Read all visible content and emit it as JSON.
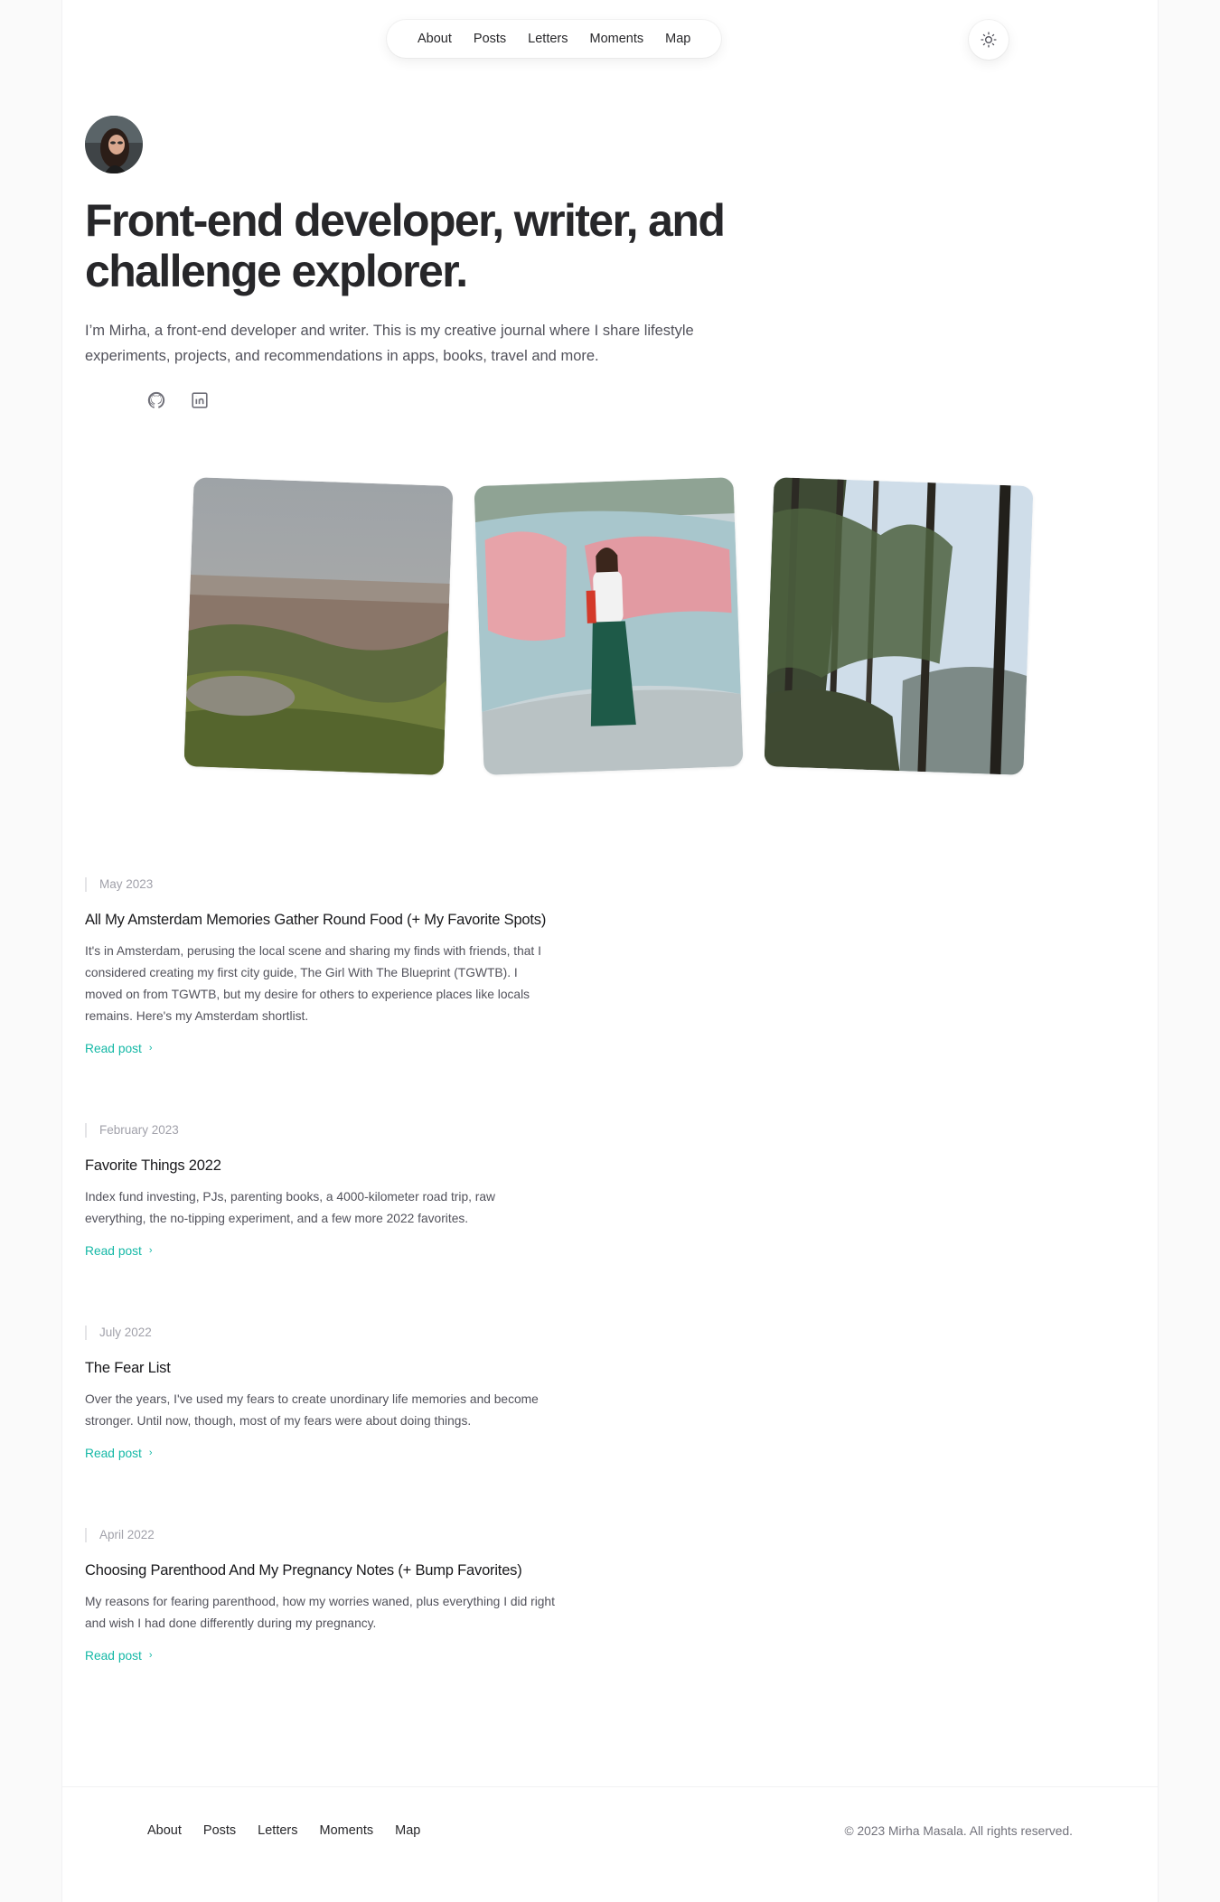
{
  "nav": {
    "items": [
      "About",
      "Posts",
      "Letters",
      "Moments",
      "Map"
    ],
    "theme_icon": "sun-icon"
  },
  "hero": {
    "avatar_alt": "avatar",
    "title": "Front-end developer, writer, and challenge explorer.",
    "intro": "I’m Mirha, a front-end developer and writer. This is my creative journal where I share lifestyle experiments, projects, and recommendations in apps, books, travel and more.",
    "social": [
      "github-icon",
      "linkedin-icon"
    ]
  },
  "photos": [
    "city-landscape-photo",
    "graffiti-wall-photo",
    "forest-trees-photo"
  ],
  "posts": [
    {
      "date": "May 2023",
      "title": "All My Amsterdam Memories Gather Round Food (+ My Favorite Spots)",
      "description": "It's in Amsterdam, perusing the local scene and sharing my finds with friends, that I considered creating my first city guide, The Girl With The Blueprint (TGWTB). I moved on from TGWTB, but my desire for others to experience places like locals remains. Here's my Amsterdam shortlist.",
      "cta": "Read post"
    },
    {
      "date": "February 2023",
      "title": "Favorite Things 2022",
      "description": "Index fund investing, PJs, parenting books, a 4000-kilometer road trip, raw everything, the no-tipping experiment, and a few more 2022 favorites.",
      "cta": "Read post"
    },
    {
      "date": "July 2022",
      "title": "The Fear List",
      "description": "Over the years, I've used my fears to create unordinary life memories and become stronger. Until now, though, most of my fears were about doing things.",
      "cta": "Read post"
    },
    {
      "date": "April 2022",
      "title": "Choosing Parenthood And My Pregnancy Notes (+ Bump Favorites)",
      "description": "My reasons for fearing parenthood, how my worries waned, plus everything I did right and wish I had done differently during my pregnancy.",
      "cta": "Read post"
    }
  ],
  "footer": {
    "items": [
      "About",
      "Posts",
      "Letters",
      "Moments",
      "Map"
    ],
    "copyright": "© 2023 Mirha Masala. All rights reserved."
  },
  "colors": {
    "accent": "#14b8a6",
    "text": "#27272a",
    "muted": "#52525b"
  }
}
